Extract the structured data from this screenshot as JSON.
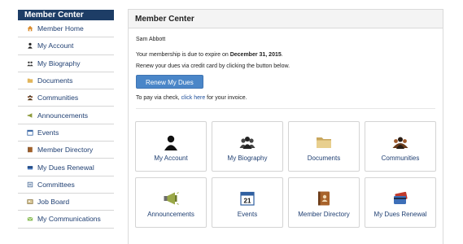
{
  "sidebar": {
    "title": "Member Center",
    "items": [
      {
        "label": "Member Home",
        "icon": "home-icon"
      },
      {
        "label": "My Account",
        "icon": "person-icon"
      },
      {
        "label": "My Biography",
        "icon": "people-icon"
      },
      {
        "label": "Documents",
        "icon": "folder-icon"
      },
      {
        "label": "Communities",
        "icon": "community-icon"
      },
      {
        "label": "Announcements",
        "icon": "megaphone-icon"
      },
      {
        "label": "Events",
        "icon": "calendar-icon"
      },
      {
        "label": "Member Directory",
        "icon": "directory-icon"
      },
      {
        "label": "My Dues Renewal",
        "icon": "credit-card-icon"
      },
      {
        "label": "Committees",
        "icon": "committee-icon"
      },
      {
        "label": "Job Board",
        "icon": "job-board-icon"
      },
      {
        "label": "My Communications",
        "icon": "mail-icon"
      }
    ]
  },
  "panel": {
    "title": "Member Center",
    "member_name": "Sam Abbott",
    "expiry_prefix": "Your membership is due to expire on ",
    "expiry_date": "December 31, 2015",
    "expiry_suffix": ".",
    "renew_text": "Renew your dues via credit card by clicking the button below.",
    "renew_button": "Renew My Dues",
    "check_prefix": "To pay via check, ",
    "check_link": "click here",
    "check_suffix": " for your invoice."
  },
  "tiles": [
    {
      "label": "My Account",
      "icon": "person-icon"
    },
    {
      "label": "My Biography",
      "icon": "people-icon"
    },
    {
      "label": "Documents",
      "icon": "folder-icon"
    },
    {
      "label": "Communities",
      "icon": "community-icon"
    },
    {
      "label": "Announcements",
      "icon": "megaphone-icon"
    },
    {
      "label": "Events",
      "icon": "calendar-icon"
    },
    {
      "label": "Member Directory",
      "icon": "directory-icon"
    },
    {
      "label": "My Dues Renewal",
      "icon": "credit-card-icon"
    }
  ],
  "calendar_day": "21",
  "colors": {
    "sidebar_header": "#1d3d66",
    "link": "#1f3f72",
    "button": "#4a86c8"
  }
}
